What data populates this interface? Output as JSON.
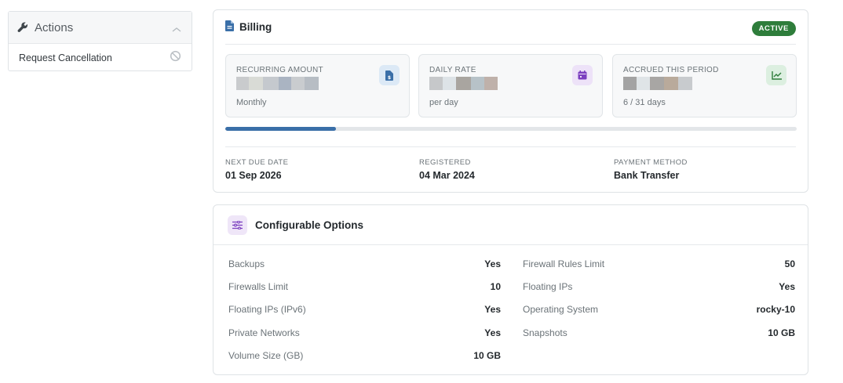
{
  "actions": {
    "title": "Actions",
    "items": [
      {
        "label": "Request Cancellation",
        "icon": "ban-icon"
      }
    ]
  },
  "billing": {
    "title": "Billing",
    "status": "ACTIVE",
    "stats": [
      {
        "label": "RECURRING AMOUNT",
        "sub": "Monthly",
        "icon": "invoice-dollar-icon",
        "value_hidden": true
      },
      {
        "label": "DAILY RATE",
        "sub": "per day",
        "icon": "calendar-icon",
        "value_hidden": true
      },
      {
        "label": "ACCRUED THIS PERIOD",
        "sub": "6 / 31 days",
        "icon": "chart-line-icon",
        "value_hidden": true
      }
    ],
    "progress_fraction": 0.1935,
    "meta": [
      {
        "label": "NEXT DUE DATE",
        "value": "01 Sep 2026"
      },
      {
        "label": "REGISTERED",
        "value": "04 Mar 2024"
      },
      {
        "label": "PAYMENT METHOD",
        "value": "Bank Transfer"
      }
    ]
  },
  "config": {
    "title": "Configurable Options",
    "left": [
      {
        "name": "Backups",
        "value": "Yes"
      },
      {
        "name": "Firewalls Limit",
        "value": "10"
      },
      {
        "name": "Floating IPs (IPv6)",
        "value": "Yes"
      },
      {
        "name": "Private Networks",
        "value": "Yes"
      },
      {
        "name": "Volume Size (GB)",
        "value": "10 GB"
      }
    ],
    "right": [
      {
        "name": "Firewall Rules Limit",
        "value": "50"
      },
      {
        "name": "Floating IPs",
        "value": "Yes"
      },
      {
        "name": "Operating System",
        "value": "rocky-10"
      },
      {
        "name": "Snapshots",
        "value": "10 GB"
      }
    ]
  },
  "colors": {
    "active_badge": "#2e7d3b",
    "progress": "#3a6fa8",
    "icon_blue_bg": "#dce9f6",
    "icon_purple_bg": "#ede2f8",
    "icon_green_bg": "#dcefe0"
  }
}
